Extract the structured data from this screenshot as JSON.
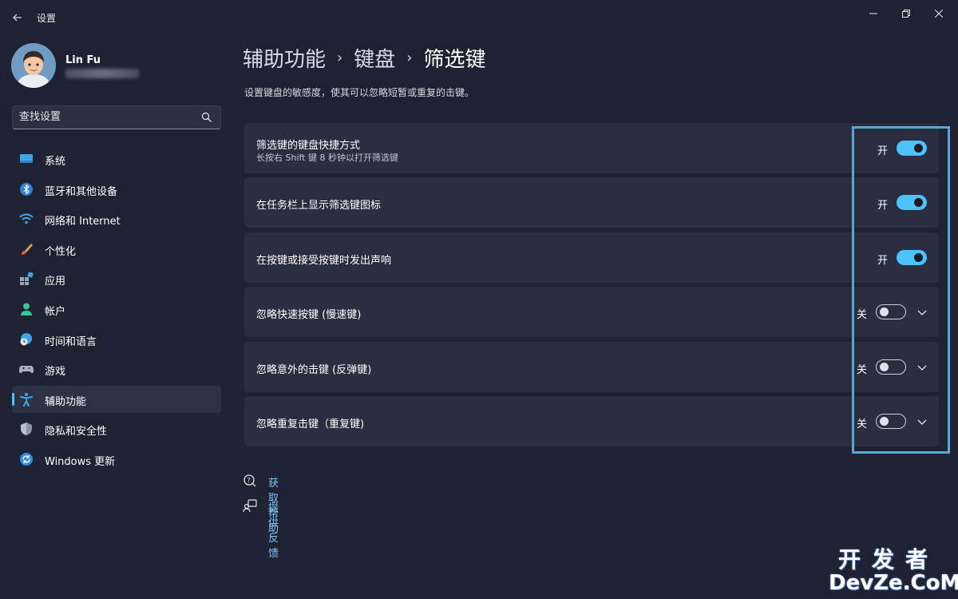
{
  "window": {
    "title": "设置"
  },
  "profile": {
    "name": "Lin Fu"
  },
  "search": {
    "placeholder": "查找设置"
  },
  "sidebar": {
    "items": [
      {
        "label": "系统",
        "icon": "system-icon"
      },
      {
        "label": "蓝牙和其他设备",
        "icon": "bluetooth-icon"
      },
      {
        "label": "网络和 Internet",
        "icon": "wifi-icon"
      },
      {
        "label": "个性化",
        "icon": "brush-icon"
      },
      {
        "label": "应用",
        "icon": "apps-icon"
      },
      {
        "label": "帐户",
        "icon": "account-icon"
      },
      {
        "label": "时间和语言",
        "icon": "globe-clock-icon"
      },
      {
        "label": "游戏",
        "icon": "gamepad-icon"
      },
      {
        "label": "辅助功能",
        "icon": "accessibility-icon",
        "active": true
      },
      {
        "label": "隐私和安全性",
        "icon": "shield-icon"
      },
      {
        "label": "Windows 更新",
        "icon": "update-icon"
      }
    ]
  },
  "breadcrumb": {
    "items": [
      "辅助功能",
      "键盘",
      "筛选键"
    ]
  },
  "description": "设置键盘的敏感度，使其可以忽略短暂或重复的击键。",
  "settings": [
    {
      "title": "筛选键的键盘快捷方式",
      "subtitle": "长按右 Shift 键 8 秒钟以打开筛选键",
      "state": "开",
      "on": true,
      "expandable": false
    },
    {
      "title": "在任务栏上显示筛选键图标",
      "state": "开",
      "on": true,
      "expandable": false
    },
    {
      "title": "在按键或接受按键时发出声响",
      "state": "开",
      "on": true,
      "expandable": false
    },
    {
      "title": "忽略快速按键 (慢速键)",
      "state": "关",
      "on": false,
      "expandable": true
    },
    {
      "title": "忽略意外的击键 (反弹键)",
      "state": "关",
      "on": false,
      "expandable": true
    },
    {
      "title": "忽略重复击键（重复键)",
      "state": "关",
      "on": false,
      "expandable": true
    }
  ],
  "links": {
    "help": "获取帮助",
    "feedback": "提供反馈"
  },
  "watermark": {
    "line1": "开发者",
    "line2": "DevZe.CoM"
  },
  "colors": {
    "accent": "#4cc2ff",
    "background": "#1f2233",
    "card": "#2a2e40",
    "highlight": "#5aa6d8"
  }
}
